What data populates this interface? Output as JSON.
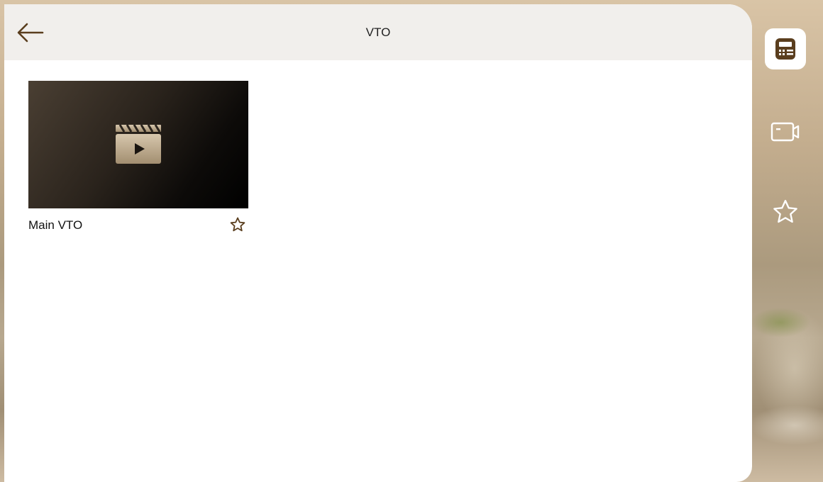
{
  "header": {
    "title": "VTO"
  },
  "devices": [
    {
      "name": "Main VTO",
      "favorite": false
    }
  ],
  "nav": {
    "items": [
      {
        "icon": "vto-device-icon",
        "active": true
      },
      {
        "icon": "camera-icon",
        "active": false
      },
      {
        "icon": "star-icon",
        "active": false
      }
    ]
  },
  "colors": {
    "accent": "#5a3e1e",
    "header_bg": "#f1efec",
    "panel_bg": "#ffffff"
  }
}
